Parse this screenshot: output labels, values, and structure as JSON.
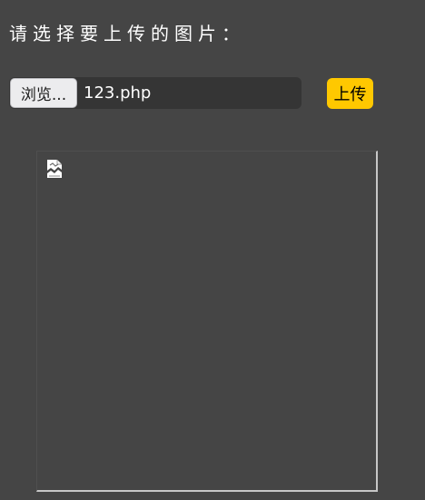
{
  "prompt": "请选择要上传的图片：",
  "file_input": {
    "browse_label": "浏览...",
    "file_name": "123.php"
  },
  "upload_label": "上传",
  "preview": {
    "icon": "broken-image-icon"
  },
  "colors": {
    "background": "#454545",
    "upload_button": "#ffc800",
    "file_field": "#353535"
  }
}
